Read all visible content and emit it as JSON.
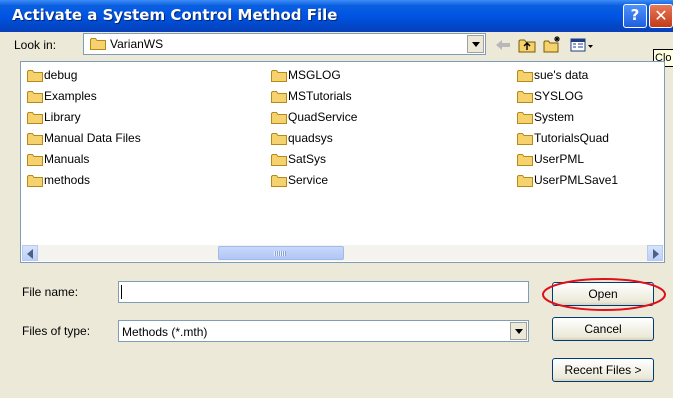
{
  "window": {
    "title": "Activate a System Control Method File",
    "help_glyph": "?",
    "close_glyph": "✕",
    "tooltip_text": "Clo"
  },
  "look_in": {
    "label": "Look in:",
    "value": "VarianWS"
  },
  "toolbar": {
    "icons": [
      "back-arrow-icon",
      "up-folder-icon",
      "new-folder-icon",
      "view-menu-icon"
    ]
  },
  "file_list": {
    "columns": [
      [
        "debug",
        "Examples",
        "Library",
        "Manual Data Files",
        "Manuals",
        "methods"
      ],
      [
        "MSGLOG",
        "MSTutorials",
        "QuadService",
        "quadsys",
        "SatSys",
        "Service"
      ],
      [
        "sue's data",
        "SYSLOG",
        "System",
        "TutorialsQuad",
        "UserPML",
        "UserPMLSave1"
      ]
    ]
  },
  "file_name": {
    "label": "File name:",
    "value": ""
  },
  "file_type": {
    "label": "Files of type:",
    "value": "Methods (*.mth)"
  },
  "buttons": {
    "open": "Open",
    "cancel": "Cancel",
    "recent": "Recent Files >"
  },
  "colors": {
    "title_bar": "#0054e3",
    "dialog_bg": "#ece9d8",
    "folder": "#f5d26e",
    "annotation_ring": "#e0101a"
  }
}
